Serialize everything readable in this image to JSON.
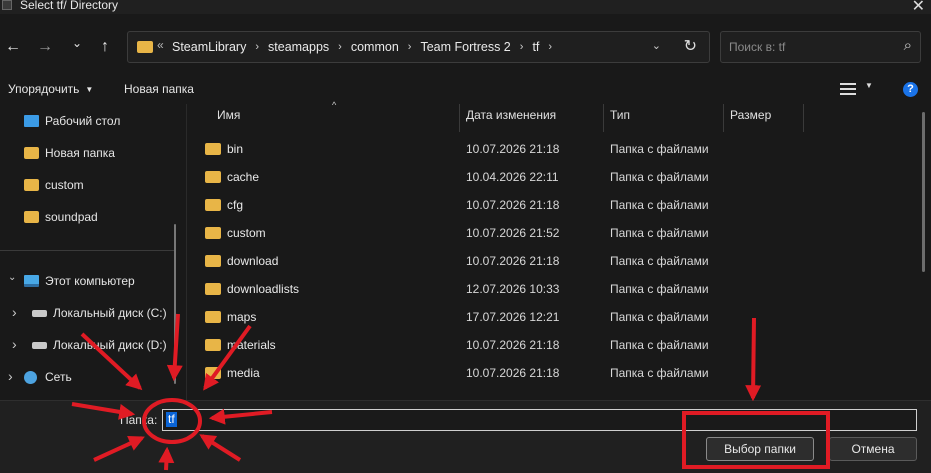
{
  "window": {
    "title": "Select tf/ Directory",
    "close_glyph": "✕"
  },
  "nav": {
    "back_glyph": "←",
    "forward_glyph": "→",
    "recent_glyph": "⌄",
    "up_glyph": "↑"
  },
  "address": {
    "overflow_glyph": "«",
    "crumbs": [
      "SteamLibrary",
      "steamapps",
      "common",
      "Team Fortress 2",
      "tf"
    ],
    "separator": "›",
    "dropdown_glyph": "⌄",
    "refresh_glyph": "↻"
  },
  "search": {
    "placeholder": "Поиск в: tf",
    "icon_glyph": "⌕"
  },
  "toolbar": {
    "organize_label": "Упорядочить",
    "new_folder_label": "Новая папка",
    "help_glyph": "?"
  },
  "sidebar": {
    "items": [
      {
        "label": "Рабочий стол",
        "icon": "desktop-icon"
      },
      {
        "label": "Новая папка",
        "icon": "folder-icon"
      },
      {
        "label": "custom",
        "icon": "folder-icon"
      },
      {
        "label": "soundpad",
        "icon": "folder-icon"
      }
    ],
    "computer": {
      "label": "Этот компьютер",
      "icon": "computer-icon"
    },
    "drives": [
      {
        "label": "Локальный диск (C:)",
        "icon": "drive-icon"
      },
      {
        "label": "Локальный диск (D:)",
        "icon": "drive-icon"
      }
    ],
    "network": {
      "label": "Сеть",
      "icon": "network-icon"
    },
    "expand_glyph": "›",
    "expanded_glyph": "⌄"
  },
  "columns": {
    "name": "Имя",
    "date": "Дата изменения",
    "type": "Тип",
    "size": "Размер",
    "sort_glyph": "^"
  },
  "files": [
    {
      "name": "bin",
      "date": "10.07.2026 21:18",
      "type": "Папка с файлами",
      "size": ""
    },
    {
      "name": "cache",
      "date": "10.04.2026 22:11",
      "type": "Папка с файлами",
      "size": ""
    },
    {
      "name": "cfg",
      "date": "10.07.2026 21:18",
      "type": "Папка с файлами",
      "size": ""
    },
    {
      "name": "custom",
      "date": "10.07.2026 21:52",
      "type": "Папка с файлами",
      "size": ""
    },
    {
      "name": "download",
      "date": "10.07.2026 21:18",
      "type": "Папка с файлами",
      "size": ""
    },
    {
      "name": "downloadlists",
      "date": "12.07.2026 10:33",
      "type": "Папка с файлами",
      "size": ""
    },
    {
      "name": "maps",
      "date": "17.07.2026 12:21",
      "type": "Папка с файлами",
      "size": ""
    },
    {
      "name": "materials",
      "date": "10.07.2026 21:18",
      "type": "Папка с файлами",
      "size": ""
    },
    {
      "name": "media",
      "date": "10.07.2026 21:18",
      "type": "Папка с файлами",
      "size": ""
    }
  ],
  "bottom": {
    "folder_label": "Папка:",
    "folder_value": "tf",
    "select_button": "Выбор папки",
    "cancel_button": "Отмена"
  },
  "colors": {
    "annotation": "#e01b24",
    "folder": "#e8b547",
    "selection": "#0a64d6"
  }
}
